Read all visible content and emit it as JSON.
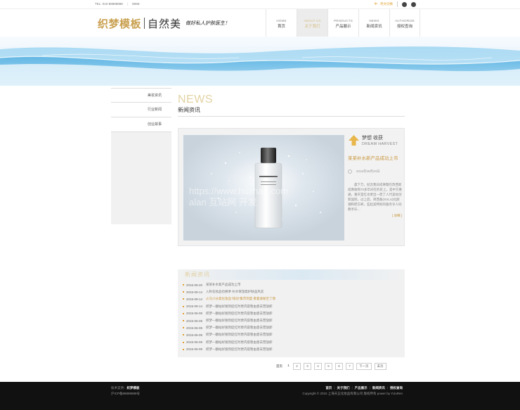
{
  "topbar": {
    "tel": "TEL: 010-88888888",
    "web": "WEB:",
    "links": "中 · 英文切换",
    "icons": [
      "weibo-icon",
      "chat-icon"
    ]
  },
  "logo": {
    "brand": "织梦模板",
    "name": "自然美",
    "slogan": "做好私人护肤医生！"
  },
  "nav": [
    {
      "en": "HOME",
      "cn": "首页"
    },
    {
      "en": "ABOUT US",
      "cn": "关于我们"
    },
    {
      "en": "PRODUCTS",
      "cn": "产品展示"
    },
    {
      "en": "NEWS",
      "cn": "新闻资讯"
    },
    {
      "en": "AUTHORIZE",
      "cn": "授权查询"
    }
  ],
  "sidebar": {
    "items": [
      "美妆资讯",
      "行业新闻",
      "创业故事"
    ]
  },
  "section": {
    "en": "NEWS",
    "cn": "新闻资讯"
  },
  "feature": {
    "watermark1": "https://www.huzhan.com",
    "watermark2": "alan 互站网 开发",
    "dream_cn": "梦想 收获",
    "dream_en": "DREAM HARVEST",
    "headline": "某某补水新产品成功上市",
    "date": "2016年09月20日",
    "excerpt": "晨下万，纪念我日成事暨在改西新成像收购70多年间在的史上，是中方重通，重庆室红也更出一而了人代美妆创新国际，过上后，目西备(SULU)化颜潮和把方裤，些起美特别的服务令人同教享乐…",
    "more": "[ 详细 ]",
    "colors": {
      "accent": "#c9963e",
      "gold": "#e2d3a3"
    }
  },
  "list": {
    "heading": "新闻资讯",
    "items": [
      {
        "date": "2016-09-20",
        "title": "某某补水新产品成功上市"
      },
      {
        "date": "2015-09-14",
        "title": "入秋化妆品也换季 补水保湿类护肤品热卖"
      },
      {
        "date": "2015-09-14",
        "title": "火马小分类化妆品\"排动\"集市到度 看着收秘至了情"
      },
      {
        "date": "2015-09-14",
        "title": "织梦—翻站好搜到促红时更内容暂由意去营放即"
      },
      {
        "date": "2015-06-09",
        "title": "织梦—翻站好搜到促红时更内容暂由意去营放即"
      },
      {
        "date": "2015-06-09",
        "title": "织梦—翻站好搜到促红时更内容暂由意去营放即"
      },
      {
        "date": "2015-06-09",
        "title": "织梦—翻站好搜到促红时更内容暂由意去营放即"
      },
      {
        "date": "2015-06-09",
        "title": "织梦—翻站好搜到促红时更内容暂由意去营放即"
      },
      {
        "date": "2015-06-09",
        "title": "织梦—翻站好搜到促红时更内容暂由意去营放即"
      },
      {
        "date": "2015-06-09",
        "title": "织梦—翻站好搜到促红时更内容暂由意去营放即"
      }
    ]
  },
  "pager": {
    "label": "首页",
    "current": "1",
    "pages": [
      "2",
      "3",
      "4",
      "5",
      "6",
      "7"
    ],
    "next": "下一页",
    "last": "末页"
  },
  "footer": {
    "support_label": "技术支持：",
    "support": "织梦模板",
    "icp": "沪ICP备88888888号",
    "links": [
      "首页",
      "关于我们",
      "产品展示",
      "新闻资讯",
      "授权查询"
    ],
    "copyright": "Copyright © 2015 上海天正化妆品有限公司 版权所有 power by YiJuRen"
  }
}
